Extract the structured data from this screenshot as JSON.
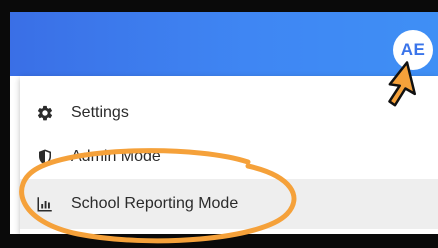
{
  "header": {
    "avatar_initials": "AE",
    "gradient_start": "#3a6fe6",
    "gradient_end": "#3f8ff5"
  },
  "menu": {
    "items": [
      {
        "label": "Settings",
        "icon": "gear-icon"
      },
      {
        "label": "Admin Mode",
        "icon": "shield-icon"
      },
      {
        "label": "School Reporting Mode",
        "icon": "bar-chart-icon",
        "highlighted": true
      }
    ]
  },
  "annotation": {
    "cursor": "pointer-arrow-icon",
    "highlight_color": "#f5a13a"
  }
}
